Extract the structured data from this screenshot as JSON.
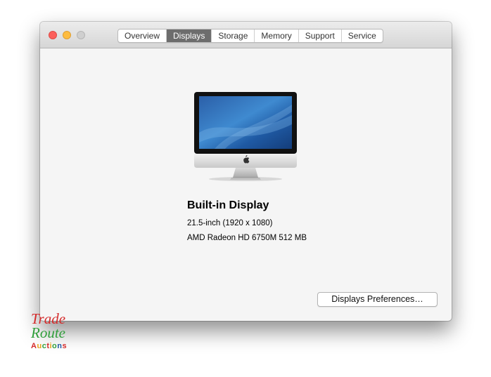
{
  "window": {
    "title_tabs": [
      {
        "label": "Overview",
        "active": false
      },
      {
        "label": "Displays",
        "active": true
      },
      {
        "label": "Storage",
        "active": false
      },
      {
        "label": "Memory",
        "active": false
      },
      {
        "label": "Support",
        "active": false
      },
      {
        "label": "Service",
        "active": false
      }
    ],
    "traffic_lights": {
      "close_color": "#fc605c",
      "minimize_color": "#fdbc40",
      "zoom_color": "#cfcfcf"
    }
  },
  "display": {
    "name": "Built-in Display",
    "size": "21.5-inch (1920 x 1080)",
    "graphics": "AMD Radeon HD 6750M 512 MB",
    "icon": "imac-icon"
  },
  "actions": {
    "preferences_label": "Displays Preferences…"
  },
  "watermark": {
    "line1": "Trade",
    "line2": "Route",
    "line3": "Auctions"
  }
}
